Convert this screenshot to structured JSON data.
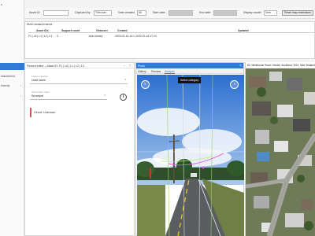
{
  "nav": {
    "items": [
      {
        "label": "s"
      },
      {
        "label": "easurement"
      },
      {
        "label": "erarchy"
      }
    ]
  },
  "filters": {
    "asset_id_label": "Asset ID",
    "asset_id_value": "",
    "captured_by_label": "Captured by",
    "captured_by_value": "This user",
    "date_created_label": "Date created",
    "date_created_value": "All",
    "start_date_label": "Start date",
    "start_date_value": "",
    "end_date_label": "End date",
    "end_date_value": "",
    "display_model_label": "Display model",
    "display_model_value": "Dew",
    "reset_button": "Reset map restrictions"
  },
  "measurements": {
    "title": "Multi measurements",
    "columns": [
      "Asset IDs",
      "Support count",
      "Observer",
      "Created",
      "Updated"
    ],
    "rows": [
      {
        "asset_ids": "F1 | L6 | L1 | L2 | L3",
        "support_count": "3",
        "observer": "John Ashley",
        "created": "2023-02-16 14:1",
        "updated": "2023-02-16 17:24"
      }
    ]
  },
  "editor": {
    "title": "Record editor – Asset ID: F1 | L6 | L1 | L2 | L3",
    "field1_small": "Feature classifier",
    "field1_value": "Lead users",
    "field2_small": "Observation value",
    "field2_value": "Surveyed",
    "circuit_label": "Circuit: Unknown"
  },
  "viewer": {
    "title": "Photo",
    "tabs": [
      "Gallery",
      "Preview",
      "Analysis"
    ],
    "active_tab": "Analysis",
    "select_category": "Select category"
  },
  "map": {
    "address": "63, Westhouse Road, Howick, Auckland, 2014, New Zealand"
  },
  "colors": {
    "accent": "#2f7bd6",
    "circuit_flag": "#d9534f"
  }
}
